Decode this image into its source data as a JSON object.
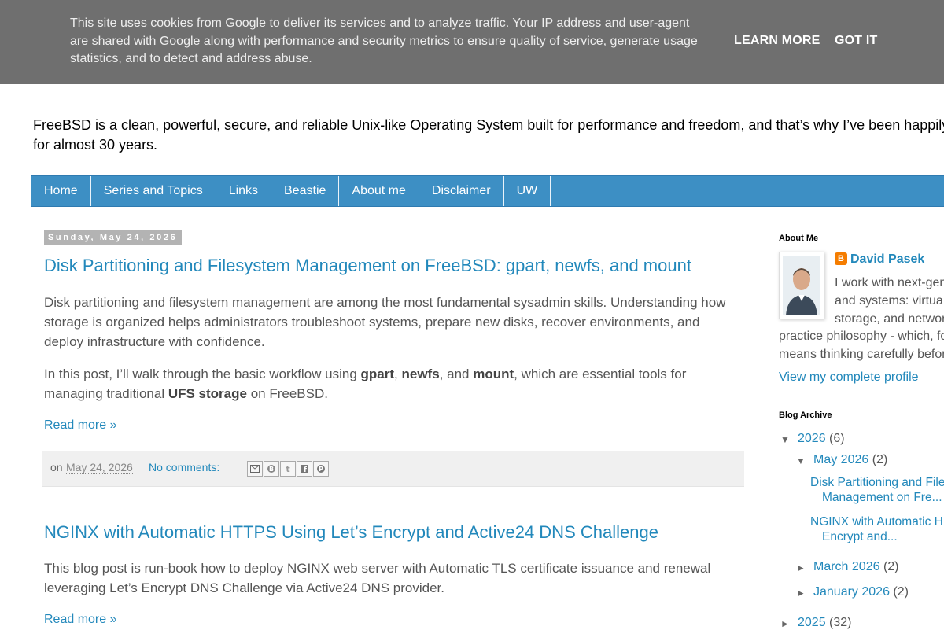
{
  "cookie_banner": {
    "text_lines": [
      "This site uses cookies from Google to deliver its services and to analyze traffic. Your IP address and user-agent",
      "are shared with Google along with performance and security metrics to ensure quality of service, generate usage",
      "statistics, and to detect and address abuse."
    ],
    "learn_more": "LEARN MORE",
    "got_it": "GOT IT"
  },
  "header": {
    "description_lines": [
      "FreeBSD is a clean, powerful, secure, and reliable Unix-like Operating System built for performance and freedom, and that’s why I’ve been happily",
      "for almost 30 years."
    ]
  },
  "nav": {
    "tabs": [
      "Home",
      "Series and Topics",
      "Links",
      "Beastie",
      "About me",
      "Disclaimer",
      "UW"
    ]
  },
  "main": {
    "date_header": "Sunday, May 24, 2026",
    "posts": [
      {
        "title": "Disk Partitioning and Filesystem Management on FreeBSD: gpart, newfs, and mount",
        "p1": "Disk partitioning and filesystem management are among the most fundamental sysadmin skills. Understanding how storage is organized helps administrators troubleshoot systems, prepare new disks, recover environments, and deploy infrastructure with confidence.",
        "p2_parts": {
          "a": "In this post, I’ll walk through the basic workflow using ",
          "b": "gpart",
          "c": ", ",
          "d": "newfs",
          "e": ", and ",
          "f": "mount",
          "g": ", which are essential tools for managing traditional ",
          "h": "UFS storage",
          "i": " on FreeBSD."
        },
        "read_more": "Read more »",
        "footer": {
          "on": "on",
          "date": "May 24, 2026",
          "comments": "No comments:"
        }
      },
      {
        "title": "NGINX with Automatic HTTPS Using Let’s Encrypt and Active24 DNS Challenge",
        "p1": "This blog post is run-book how to deploy NGINX web server with Automatic TLS certificate issuance and renewal leveraging Let’s Encrypt DNS Challenge via Active24 DNS provider.",
        "read_more": "Read more »"
      }
    ],
    "share_icons": [
      "email-icon",
      "blogthis-icon",
      "twitter-icon",
      "facebook-icon",
      "pinterest-icon"
    ]
  },
  "sidebar": {
    "about": {
      "heading": "About Me",
      "name": "David Pasek",
      "bio_lines": [
        "I work with next-gen",
        "and systems: virtua",
        "storage, and networ",
        "practice philosophy - which, fo",
        "means thinking carefully befor"
      ],
      "profile_link": "View my complete profile"
    },
    "archive": {
      "heading": "Blog Archive",
      "year_2026": "2026",
      "year_2026_count": "(6)",
      "may_2026": "May 2026",
      "may_2026_count": "(2)",
      "post1_l1": "Disk Partitioning and File",
      "post1_l2": "Management on Fre...",
      "post2_l1": "NGINX with Automatic H",
      "post2_l2": "Encrypt and...",
      "march_2026": "March 2026",
      "march_2026_count": "(2)",
      "january_2026": "January 2026",
      "january_2026_count": "(2)",
      "year_2025": "2025",
      "year_2025_count": "(32)"
    }
  }
}
